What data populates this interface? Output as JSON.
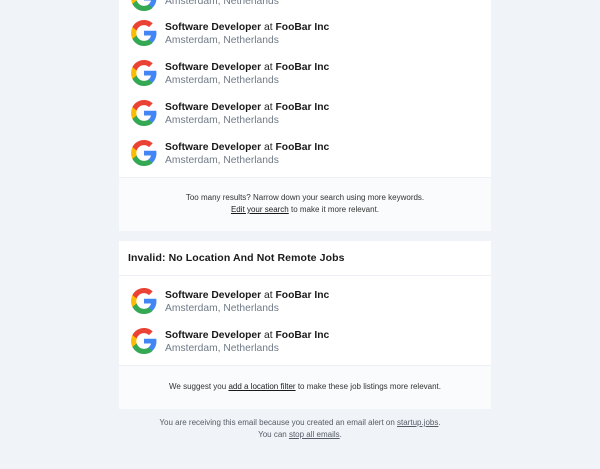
{
  "partial_job": {
    "location": "Amsterdam, Netherlands"
  },
  "section1": {
    "jobs": [
      {
        "title": "Software Developer",
        "at": "at",
        "company": "FooBar Inc",
        "location": "Amsterdam, Netherlands"
      },
      {
        "title": "Software Developer",
        "at": "at",
        "company": "FooBar Inc",
        "location": "Amsterdam, Netherlands"
      },
      {
        "title": "Software Developer",
        "at": "at",
        "company": "FooBar Inc",
        "location": "Amsterdam, Netherlands"
      },
      {
        "title": "Software Developer",
        "at": "at",
        "company": "FooBar Inc",
        "location": "Amsterdam, Netherlands"
      }
    ],
    "footer_line1": "Too many results? Narrow down your search using more keywords.",
    "footer_link": "Edit your search",
    "footer_line2_rest": " to make it more relevant."
  },
  "section2": {
    "title": "Invalid: No Location And Not Remote Jobs",
    "jobs": [
      {
        "title": "Software Developer",
        "at": "at",
        "company": "FooBar Inc",
        "location": "Amsterdam, Netherlands"
      },
      {
        "title": "Software Developer",
        "at": "at",
        "company": "FooBar Inc",
        "location": "Amsterdam, Netherlands"
      }
    ],
    "footer_pre": "We suggest you ",
    "footer_link": "add a location filter",
    "footer_post": " to make these job listings more relevant."
  },
  "bottom": {
    "line1_pre": "You are receiving this email because you created an email alert on ",
    "site_link": "startup.jobs",
    "line1_post": ".",
    "line2_pre": "You can ",
    "stop_link": "stop all emails",
    "line2_post": "."
  },
  "icons": {
    "company_logo": "google-g-logo"
  },
  "colors": {
    "background": "#f0f3f7",
    "card": "#ffffff",
    "location_text": "#6f7a86"
  }
}
